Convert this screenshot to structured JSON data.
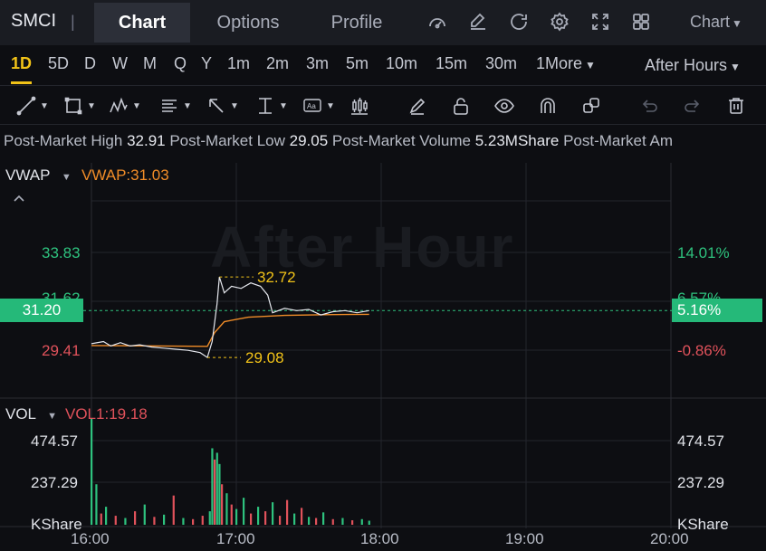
{
  "header": {
    "symbol": "SMCI",
    "separator": "|",
    "tabs": [
      {
        "label": "Chart",
        "active": true
      },
      {
        "label": "Options",
        "active": false
      },
      {
        "label": "Profile",
        "active": false
      }
    ],
    "icons": [
      "gauge-icon",
      "edit-icon",
      "refresh-icon",
      "settings-icon",
      "fullscreen-icon",
      "grid-icon"
    ],
    "chart_menu_label": "Chart"
  },
  "periods": {
    "items": [
      "1D",
      "5D",
      "D",
      "W",
      "M",
      "Q",
      "Y",
      "1m",
      "2m",
      "3m",
      "5m",
      "10m",
      "15m",
      "30m",
      "1More"
    ],
    "active": "1D",
    "session_label": "After Hours"
  },
  "toolbar": {
    "tools": [
      "line-tool-icon",
      "rectangle-tool-icon",
      "pattern-tool-icon",
      "fibonacci-tool-icon",
      "arrow-tool-icon",
      "measure-tool-icon",
      "text-tool-icon",
      "candlestick-tool-icon",
      "pencil-icon",
      "unlock-icon",
      "eye-icon",
      "magnet-icon",
      "layers-icon",
      "undo-icon",
      "redo-icon",
      "trash-icon"
    ]
  },
  "stats": {
    "high_label": "Post-Market High",
    "high_value": "32.91",
    "low_label": "Post-Market Low",
    "low_value": "29.05",
    "volume_label": "Post-Market Volume",
    "volume_value": "5.23MShare",
    "amount_label": "Post-Market Am"
  },
  "price_panel": {
    "indicator_name": "VWAP",
    "indicator_value_label": "VWAP:31.03",
    "watermark": "After Hour",
    "y_left_upper": "33.83",
    "y_left_current": "31.20",
    "y_left_lower": "29.41",
    "y_left_hidden": "31.62",
    "y_right_upper": "14.01%",
    "y_right_current": "5.16%",
    "y_right_lower": "-0.86%",
    "y_right_hidden": "6.57%",
    "high_marker": "32.72",
    "low_marker": "29.08"
  },
  "volume_panel": {
    "indicator_name": "VOL",
    "indicator_value_label": "VOL1:19.18",
    "y_upper": "474.57",
    "y_mid": "237.29",
    "y_unit": "KShare"
  },
  "x_axis": {
    "labels": [
      "16:00",
      "17:00",
      "18:00",
      "19:00",
      "20:00"
    ]
  },
  "colors": {
    "up": "#2ec27e",
    "down": "#e0525b",
    "vwap": "#f08c28",
    "marker": "#f2c318",
    "background": "#0d0e12"
  },
  "chart_data": {
    "type": "line",
    "x_range": [
      "16:00",
      "20:00"
    ],
    "ylim": [
      29.0,
      34.2
    ],
    "price_series": [
      {
        "t": "16:00",
        "v": 29.7
      },
      {
        "t": "16:05",
        "v": 29.8
      },
      {
        "t": "16:08",
        "v": 29.6
      },
      {
        "t": "16:12",
        "v": 29.75
      },
      {
        "t": "16:16",
        "v": 29.6
      },
      {
        "t": "16:20",
        "v": 29.65
      },
      {
        "t": "16:25",
        "v": 29.55
      },
      {
        "t": "16:30",
        "v": 29.5
      },
      {
        "t": "16:35",
        "v": 29.45
      },
      {
        "t": "16:40",
        "v": 29.4
      },
      {
        "t": "16:45",
        "v": 29.3
      },
      {
        "t": "16:48",
        "v": 29.08
      },
      {
        "t": "16:50",
        "v": 29.8
      },
      {
        "t": "16:52",
        "v": 31.5
      },
      {
        "t": "16:53",
        "v": 32.72
      },
      {
        "t": "16:55",
        "v": 32.0
      },
      {
        "t": "16:58",
        "v": 32.3
      },
      {
        "t": "17:02",
        "v": 32.2
      },
      {
        "t": "17:06",
        "v": 32.45
      },
      {
        "t": "17:10",
        "v": 32.3
      },
      {
        "t": "17:13",
        "v": 31.9
      },
      {
        "t": "17:15",
        "v": 31.1
      },
      {
        "t": "17:20",
        "v": 31.3
      },
      {
        "t": "17:25",
        "v": 31.2
      },
      {
        "t": "17:30",
        "v": 31.25
      },
      {
        "t": "17:35",
        "v": 31.0
      },
      {
        "t": "17:40",
        "v": 31.15
      },
      {
        "t": "17:45",
        "v": 31.2
      },
      {
        "t": "17:50",
        "v": 31.1
      },
      {
        "t": "17:55",
        "v": 31.2
      }
    ],
    "vwap_series": [
      {
        "t": "16:00",
        "v": 29.62
      },
      {
        "t": "16:30",
        "v": 29.6
      },
      {
        "t": "16:48",
        "v": 29.58
      },
      {
        "t": "16:51",
        "v": 30.2
      },
      {
        "t": "16:55",
        "v": 30.7
      },
      {
        "t": "17:05",
        "v": 30.9
      },
      {
        "t": "17:20",
        "v": 30.98
      },
      {
        "t": "17:40",
        "v": 31.02
      },
      {
        "t": "17:55",
        "v": 31.03
      }
    ],
    "volume_max": 474.57,
    "volume_series": [
      {
        "t": "16:00",
        "v": 474.57,
        "dir": "up"
      },
      {
        "t": "16:02",
        "v": 180,
        "dir": "up"
      },
      {
        "t": "16:04",
        "v": 50,
        "dir": "down"
      },
      {
        "t": "16:06",
        "v": 80,
        "dir": "up"
      },
      {
        "t": "16:10",
        "v": 40,
        "dir": "down"
      },
      {
        "t": "16:14",
        "v": 30,
        "dir": "up"
      },
      {
        "t": "16:18",
        "v": 60,
        "dir": "down"
      },
      {
        "t": "16:22",
        "v": 90,
        "dir": "up"
      },
      {
        "t": "16:26",
        "v": 35,
        "dir": "down"
      },
      {
        "t": "16:30",
        "v": 45,
        "dir": "up"
      },
      {
        "t": "16:34",
        "v": 130,
        "dir": "down"
      },
      {
        "t": "16:38",
        "v": 30,
        "dir": "up"
      },
      {
        "t": "16:42",
        "v": 25,
        "dir": "down"
      },
      {
        "t": "16:46",
        "v": 40,
        "dir": "down"
      },
      {
        "t": "16:49",
        "v": 60,
        "dir": "up"
      },
      {
        "t": "16:50",
        "v": 340,
        "dir": "up"
      },
      {
        "t": "16:51",
        "v": 290,
        "dir": "red"
      },
      {
        "t": "16:52",
        "v": 320,
        "dir": "up"
      },
      {
        "t": "16:53",
        "v": 270,
        "dir": "up"
      },
      {
        "t": "16:54",
        "v": 180,
        "dir": "down"
      },
      {
        "t": "16:56",
        "v": 140,
        "dir": "up"
      },
      {
        "t": "16:58",
        "v": 90,
        "dir": "down"
      },
      {
        "t": "17:00",
        "v": 70,
        "dir": "up"
      },
      {
        "t": "17:03",
        "v": 120,
        "dir": "up"
      },
      {
        "t": "17:06",
        "v": 50,
        "dir": "down"
      },
      {
        "t": "17:09",
        "v": 80,
        "dir": "up"
      },
      {
        "t": "17:12",
        "v": 60,
        "dir": "down"
      },
      {
        "t": "17:15",
        "v": 100,
        "dir": "up"
      },
      {
        "t": "17:18",
        "v": 40,
        "dir": "down"
      },
      {
        "t": "17:21",
        "v": 110,
        "dir": "down"
      },
      {
        "t": "17:24",
        "v": 50,
        "dir": "up"
      },
      {
        "t": "17:27",
        "v": 75,
        "dir": "down"
      },
      {
        "t": "17:30",
        "v": 35,
        "dir": "up"
      },
      {
        "t": "17:33",
        "v": 30,
        "dir": "down"
      },
      {
        "t": "17:36",
        "v": 55,
        "dir": "up"
      },
      {
        "t": "17:40",
        "v": 25,
        "dir": "down"
      },
      {
        "t": "17:44",
        "v": 30,
        "dir": "up"
      },
      {
        "t": "17:48",
        "v": 20,
        "dir": "down"
      },
      {
        "t": "17:52",
        "v": 25,
        "dir": "up"
      },
      {
        "t": "17:55",
        "v": 18,
        "dir": "up"
      }
    ]
  }
}
